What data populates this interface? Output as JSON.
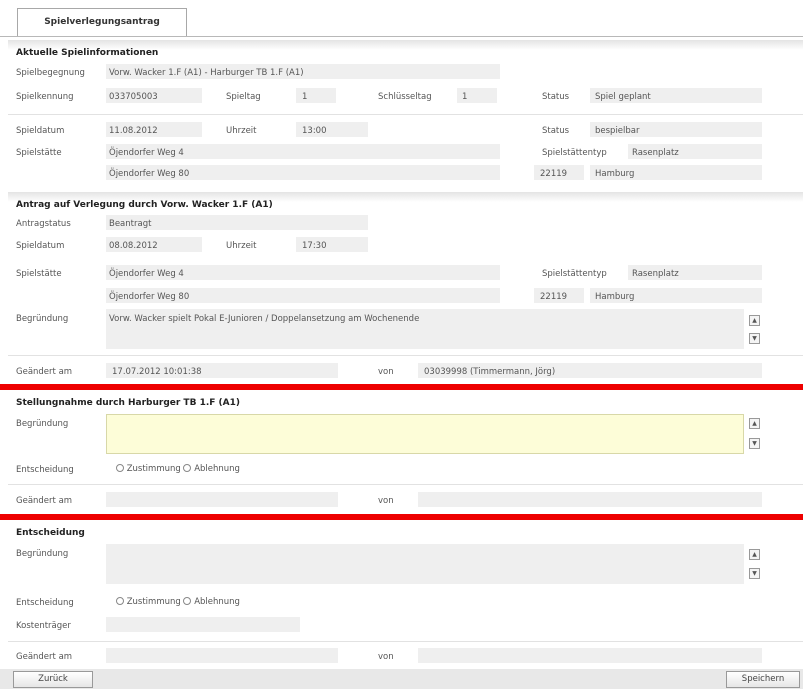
{
  "tab": "Spielverlegungsantrag",
  "current": {
    "title": "Aktuelle Spielinformationen",
    "labels": {
      "spielbegegnung": "Spielbegegnung",
      "spielkennung": "Spielkennung",
      "spieltag": "Spieltag",
      "schluesseltag": "Schlüsseltag",
      "status": "Status",
      "spieldatum": "Spieldatum",
      "uhrzeit": "Uhrzeit",
      "platzstatus": "Status",
      "spielstaette": "Spielstätte",
      "spielstaettentyp": "Spielstättentyp"
    },
    "spielbegegnung": "Vorw. Wacker 1.F (A1) - Harburger TB 1.F (A1)",
    "spielkennung": "033705003",
    "spieltag": "1",
    "schluesseltag": "1",
    "status": "Spiel geplant",
    "spieldatum": "11.08.2012",
    "uhrzeit": "13:00",
    "platzstatus": "bespielbar",
    "spielstaette1": "Öjendorfer Weg 4",
    "spielstaette2": "Öjendorfer Weg 80",
    "spielstaettentyp": "Rasenplatz",
    "plz": "22119",
    "ort": "Hamburg"
  },
  "antrag": {
    "title": "Antrag auf Verlegung durch Vorw. Wacker 1.F (A1)",
    "labels": {
      "antragstatus": "Antragstatus",
      "spieldatum": "Spieldatum",
      "uhrzeit": "Uhrzeit",
      "spielstaette": "Spielstätte",
      "spielstaettentyp": "Spielstättentyp",
      "begruendung": "Begründung",
      "geaendert_am": "Geändert am",
      "von": "von"
    },
    "antragstatus": "Beantragt",
    "spieldatum": "08.08.2012",
    "uhrzeit": "17:30",
    "spielstaette1": "Öjendorfer Weg 4",
    "spielstaette2": "Öjendorfer Weg 80",
    "spielstaettentyp": "Rasenplatz",
    "plz": "22119",
    "ort": "Hamburg",
    "begruendung": "Vorw. Wacker spielt Pokal E-Junioren / Doppelansetzung am Wochenende",
    "geaendert_am": "17.07.2012 10:01:38",
    "von": "03039998 (Timmermann, Jörg)"
  },
  "stellungnahme": {
    "title": "Stellungnahme durch Harburger TB 1.F (A1)",
    "labels": {
      "begruendung": "Begründung",
      "entscheidung": "Entscheidung",
      "geaendert_am": "Geändert am",
      "von": "von"
    },
    "option_zustimmung": "Zustimmung",
    "option_ablehnung": "Ablehnung"
  },
  "entscheidung": {
    "title": "Entscheidung",
    "labels": {
      "begruendung": "Begründung",
      "entscheidung": "Entscheidung",
      "kostentraeger": "Kostenträger",
      "geaendert_am": "Geändert am",
      "von": "von"
    },
    "option_zustimmung": "Zustimmung",
    "option_ablehnung": "Ablehnung"
  },
  "buttons": {
    "zurueck": "Zurück",
    "speichern": "Speichern"
  },
  "icons": {
    "scroll_up": "scroll-up-icon",
    "scroll_down": "scroll-down-icon",
    "radio": "radio-button"
  },
  "colors": {
    "separator_red": "#ee0000",
    "field_gray": "#efefef",
    "field_yellow": "#fdfdd8"
  }
}
